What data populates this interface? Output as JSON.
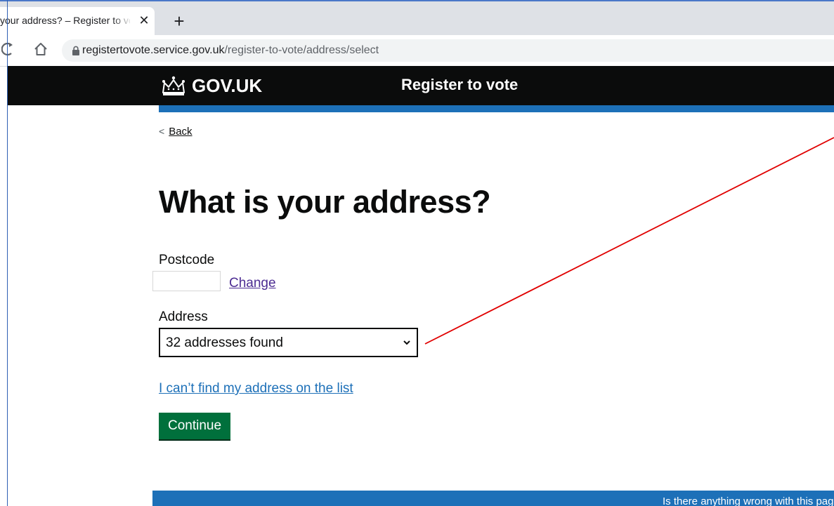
{
  "browser": {
    "tab_title": "your address? – Register to vote",
    "tab_close_glyph": "✕",
    "new_tab_glyph": "+",
    "url_host": "registertovote.service.gov.uk",
    "url_path": "/register-to-vote/address/select"
  },
  "header": {
    "logo_text": "GOV.UK",
    "service_name": "Register to vote"
  },
  "nav": {
    "back_label": "Back"
  },
  "page": {
    "title": "What is your address?",
    "postcode_label": "Postcode",
    "postcode_value": "",
    "change_link": "Change",
    "address_label": "Address",
    "address_selected": "32 addresses found",
    "cant_find_link": "I can’t find my address on the list",
    "continue_button": "Continue"
  },
  "footer": {
    "feedback_text": "Is there anything wrong with this page?"
  },
  "colors": {
    "gov_black": "#0b0c0c",
    "gov_blue": "#1d70b8",
    "button_green": "#00703c",
    "visited_link": "#4c2c92",
    "annotation_line": "#e00000"
  },
  "icons": [
    "reload-icon",
    "home-icon",
    "lock-icon",
    "crown-icon",
    "chevron-left-icon",
    "chevron-down-icon",
    "close-icon",
    "plus-icon"
  ]
}
